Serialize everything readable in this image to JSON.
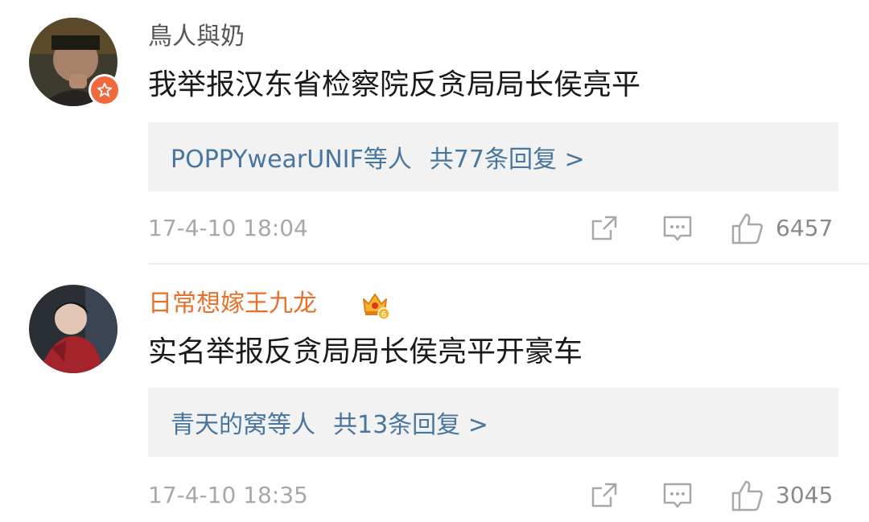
{
  "comments": [
    {
      "username": "鳥人與奶",
      "text": "我举报汉东省检察院反贪局局长侯亮平",
      "replies_names": "POPPYwearUNIF等人",
      "replies_count": "共77条回复 >",
      "timestamp": "17-4-10 18:04",
      "likes": "6457",
      "badge_icon": "star-badge-icon"
    },
    {
      "username": "日常想嫁王九龙",
      "text": "实名举报反贪局局长侯亮平开豪车",
      "replies_names": "青天的窝等人",
      "replies_count": "共13条回复 >",
      "timestamp": "17-4-10 18:35",
      "likes": "3045",
      "badge_icon": "crown-badge-icon",
      "badge_level": "6"
    }
  ],
  "colors": {
    "link": "#48769f",
    "vip_name": "#e8702a",
    "badge": "#f0683c",
    "meta": "#a8a8a8"
  }
}
